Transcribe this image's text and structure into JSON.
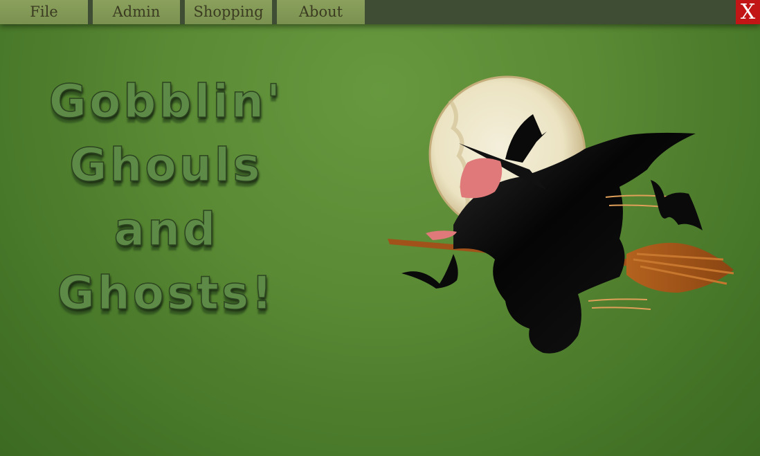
{
  "menu": {
    "items": [
      {
        "label": "File"
      },
      {
        "label": "Admin"
      },
      {
        "label": "Shopping"
      },
      {
        "label": "About"
      }
    ],
    "close_label": "X"
  },
  "title": {
    "lines": [
      "Gobblin'",
      "Ghouls",
      "and",
      "Ghosts!"
    ]
  },
  "illustration": {
    "icon": "witch-on-broom-moon-icon"
  },
  "colors": {
    "menubar": "#3f4d35",
    "menu_item": "#7b9150",
    "close": "#c21616",
    "background": "#5a8a34",
    "title_text": "#5d8a46"
  }
}
